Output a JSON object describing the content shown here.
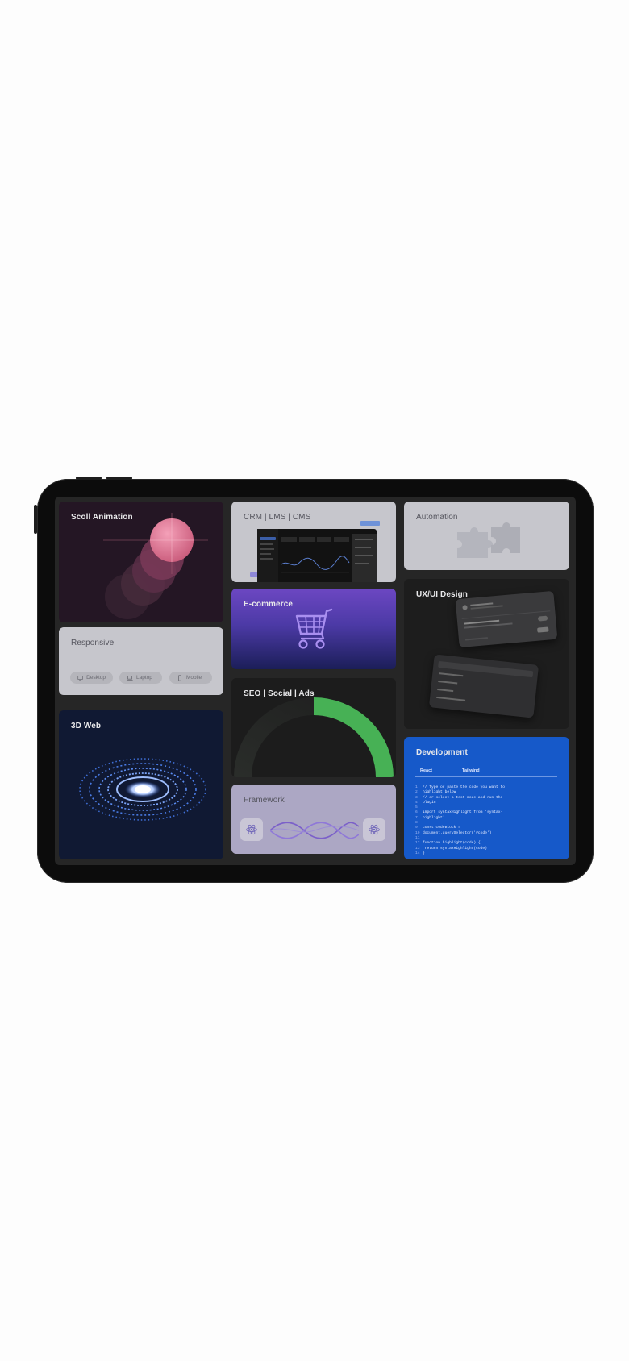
{
  "cards": {
    "scroll_animation": {
      "title": "Scoll Animation"
    },
    "crm": {
      "title": "CRM | LMS | CMS"
    },
    "automation": {
      "title": "Automation"
    },
    "ecommerce": {
      "title": "E-commerce"
    },
    "uxui": {
      "title": "UX/UI Design"
    },
    "responsive": {
      "title": "Responsive",
      "devices": [
        "Desktop",
        "Laptop",
        "Mobile"
      ]
    },
    "seo": {
      "title": "SEO | Social | Ads",
      "gauge_fraction": 0.5
    },
    "web3d": {
      "title": "3D Web"
    },
    "framework": {
      "title": "Framework"
    },
    "development": {
      "title": "Development",
      "tabs": [
        "React",
        "Tailwind"
      ],
      "code_lines": [
        {
          "n": "1",
          "t": "// Type or paste the code you want to"
        },
        {
          "n": "2",
          "t": "highlight below"
        },
        {
          "n": "3",
          "t": "// or select a test mode and run the"
        },
        {
          "n": "4",
          "t": "plugin"
        },
        {
          "n": "5",
          "t": ""
        },
        {
          "n": "6",
          "t": "import syntaxHighlight from 'syntax-"
        },
        {
          "n": "7",
          "t": "highlight'"
        },
        {
          "n": "8",
          "t": ""
        },
        {
          "n": "9",
          "t": "const codeBlock ="
        },
        {
          "n": "10",
          "t": "document.querySelector('#code')"
        },
        {
          "n": "11",
          "t": ""
        },
        {
          "n": "12",
          "t": "function highlight(code) {"
        },
        {
          "n": "13",
          "t": "  return syntaxHighlight(code)"
        },
        {
          "n": "14",
          "t": "}"
        }
      ]
    }
  },
  "colors": {
    "development_bg": "#1659c9",
    "ecommerce_top": "#6d47c1",
    "seo_gauge": "#47b155",
    "scroll_ball": "#e07290"
  }
}
